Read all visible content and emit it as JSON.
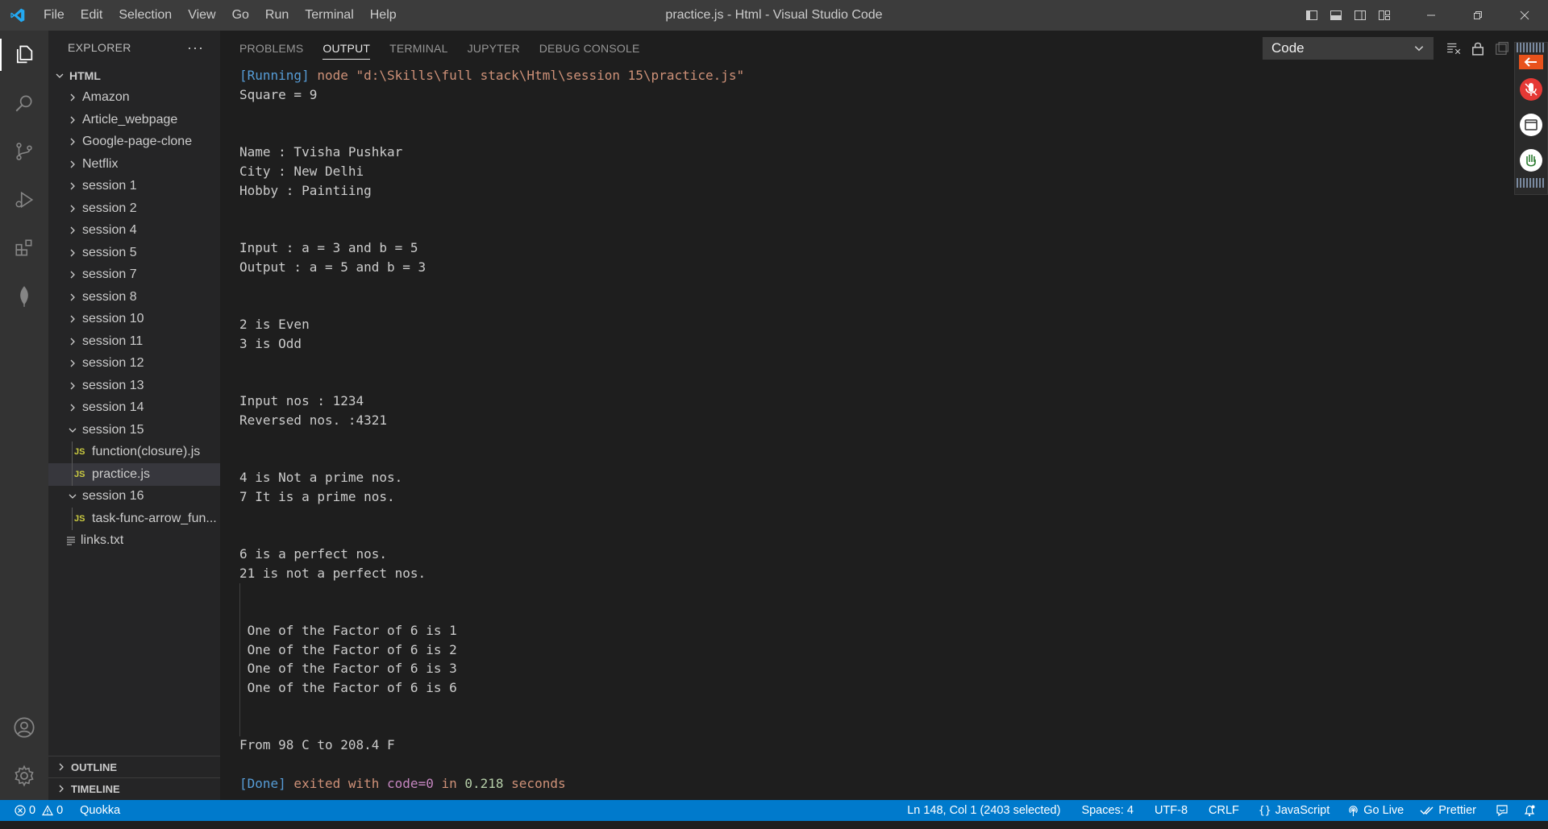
{
  "app": {
    "window_title": "practice.js - Html - Visual Studio Code",
    "menu": [
      "File",
      "Edit",
      "Selection",
      "View",
      "Go",
      "Run",
      "Terminal",
      "Help"
    ]
  },
  "sidebar": {
    "title": "EXPLORER",
    "more": "···",
    "root": "HTML",
    "items": [
      {
        "label": "Amazon",
        "type": "folder",
        "expanded": false,
        "depth": 1
      },
      {
        "label": "Article_webpage",
        "type": "folder",
        "expanded": false,
        "depth": 1
      },
      {
        "label": "Google-page-clone",
        "type": "folder",
        "expanded": false,
        "depth": 1
      },
      {
        "label": "Netflix",
        "type": "folder",
        "expanded": false,
        "depth": 1
      },
      {
        "label": "session 1",
        "type": "folder",
        "expanded": false,
        "depth": 1
      },
      {
        "label": "session 2",
        "type": "folder",
        "expanded": false,
        "depth": 1
      },
      {
        "label": "session 4",
        "type": "folder",
        "expanded": false,
        "depth": 1
      },
      {
        "label": "session 5",
        "type": "folder",
        "expanded": false,
        "depth": 1
      },
      {
        "label": "session 7",
        "type": "folder",
        "expanded": false,
        "depth": 1
      },
      {
        "label": "session 8",
        "type": "folder",
        "expanded": false,
        "depth": 1
      },
      {
        "label": "session 10",
        "type": "folder",
        "expanded": false,
        "depth": 1
      },
      {
        "label": "session 11",
        "type": "folder",
        "expanded": false,
        "depth": 1
      },
      {
        "label": "session 12",
        "type": "folder",
        "expanded": false,
        "depth": 1
      },
      {
        "label": "session 13",
        "type": "folder",
        "expanded": false,
        "depth": 1
      },
      {
        "label": "session 14",
        "type": "folder",
        "expanded": false,
        "depth": 1
      },
      {
        "label": "session 15",
        "type": "folder",
        "expanded": true,
        "depth": 1
      },
      {
        "label": "function(closure).js",
        "type": "js",
        "depth": 2
      },
      {
        "label": "practice.js",
        "type": "js",
        "depth": 2,
        "selected": true
      },
      {
        "label": "session 16",
        "type": "folder",
        "expanded": true,
        "depth": 1
      },
      {
        "label": "task-func-arrow_fun...",
        "type": "js",
        "depth": 2
      },
      {
        "label": "links.txt",
        "type": "txt",
        "depth": 1
      }
    ],
    "outline": "OUTLINE",
    "timeline": "TIMELINE"
  },
  "panel": {
    "tabs": [
      {
        "label": "PROBLEMS",
        "active": false
      },
      {
        "label": "OUTPUT",
        "active": true
      },
      {
        "label": "TERMINAL",
        "active": false
      },
      {
        "label": "JUPYTER",
        "active": false
      },
      {
        "label": "DEBUG CONSOLE",
        "active": false
      }
    ],
    "channel": "Code"
  },
  "output": {
    "running_tag": "[Running]",
    "command": " node \"d:\\Skills\\full stack\\Html\\session 15\\practice.js\"",
    "lines": [
      "Square = 9",
      "",
      "",
      "Name : Tvisha Pushkar",
      "City : New Delhi",
      "Hobby : Paintiing",
      "",
      "",
      "Input : a = 3 and b = 5",
      "Output : a = 5 and b = 3",
      "",
      "",
      "2 is Even",
      "3 is Odd",
      "",
      "",
      "Input nos : 1234",
      "Reversed nos. :4321",
      "",
      "",
      "4 is Not a prime nos.",
      "7 It is a prime nos.",
      "",
      "",
      "6 is a perfect nos.",
      "21 is not a perfect nos.",
      "",
      "",
      " One of the Factor of 6 is 1",
      " One of the Factor of 6 is 2",
      " One of the Factor of 6 is 3",
      " One of the Factor of 6 is 6",
      "",
      "",
      "From 98 C to 208.4 F",
      ""
    ],
    "done_tag": "[Done]",
    "done_text_1": " exited with ",
    "done_code": "code=0",
    "done_text_2": " in ",
    "done_time": "0.218",
    "done_text_3": " seconds"
  },
  "statusbar": {
    "errors": "0",
    "warnings": "0",
    "quokka": "Quokka",
    "cursor": "Ln 148, Col 1 (2403 selected)",
    "spaces": "Spaces: 4",
    "encoding": "UTF-8",
    "eol": "CRLF",
    "language": "JavaScript",
    "golive": "Go Live",
    "prettier": "Prettier"
  },
  "colors": {
    "statusbar": "#007acc",
    "titlebar": "#3c3c3c",
    "activitybar": "#333333",
    "sidebar": "#252526",
    "editor": "#1e1e1e"
  }
}
